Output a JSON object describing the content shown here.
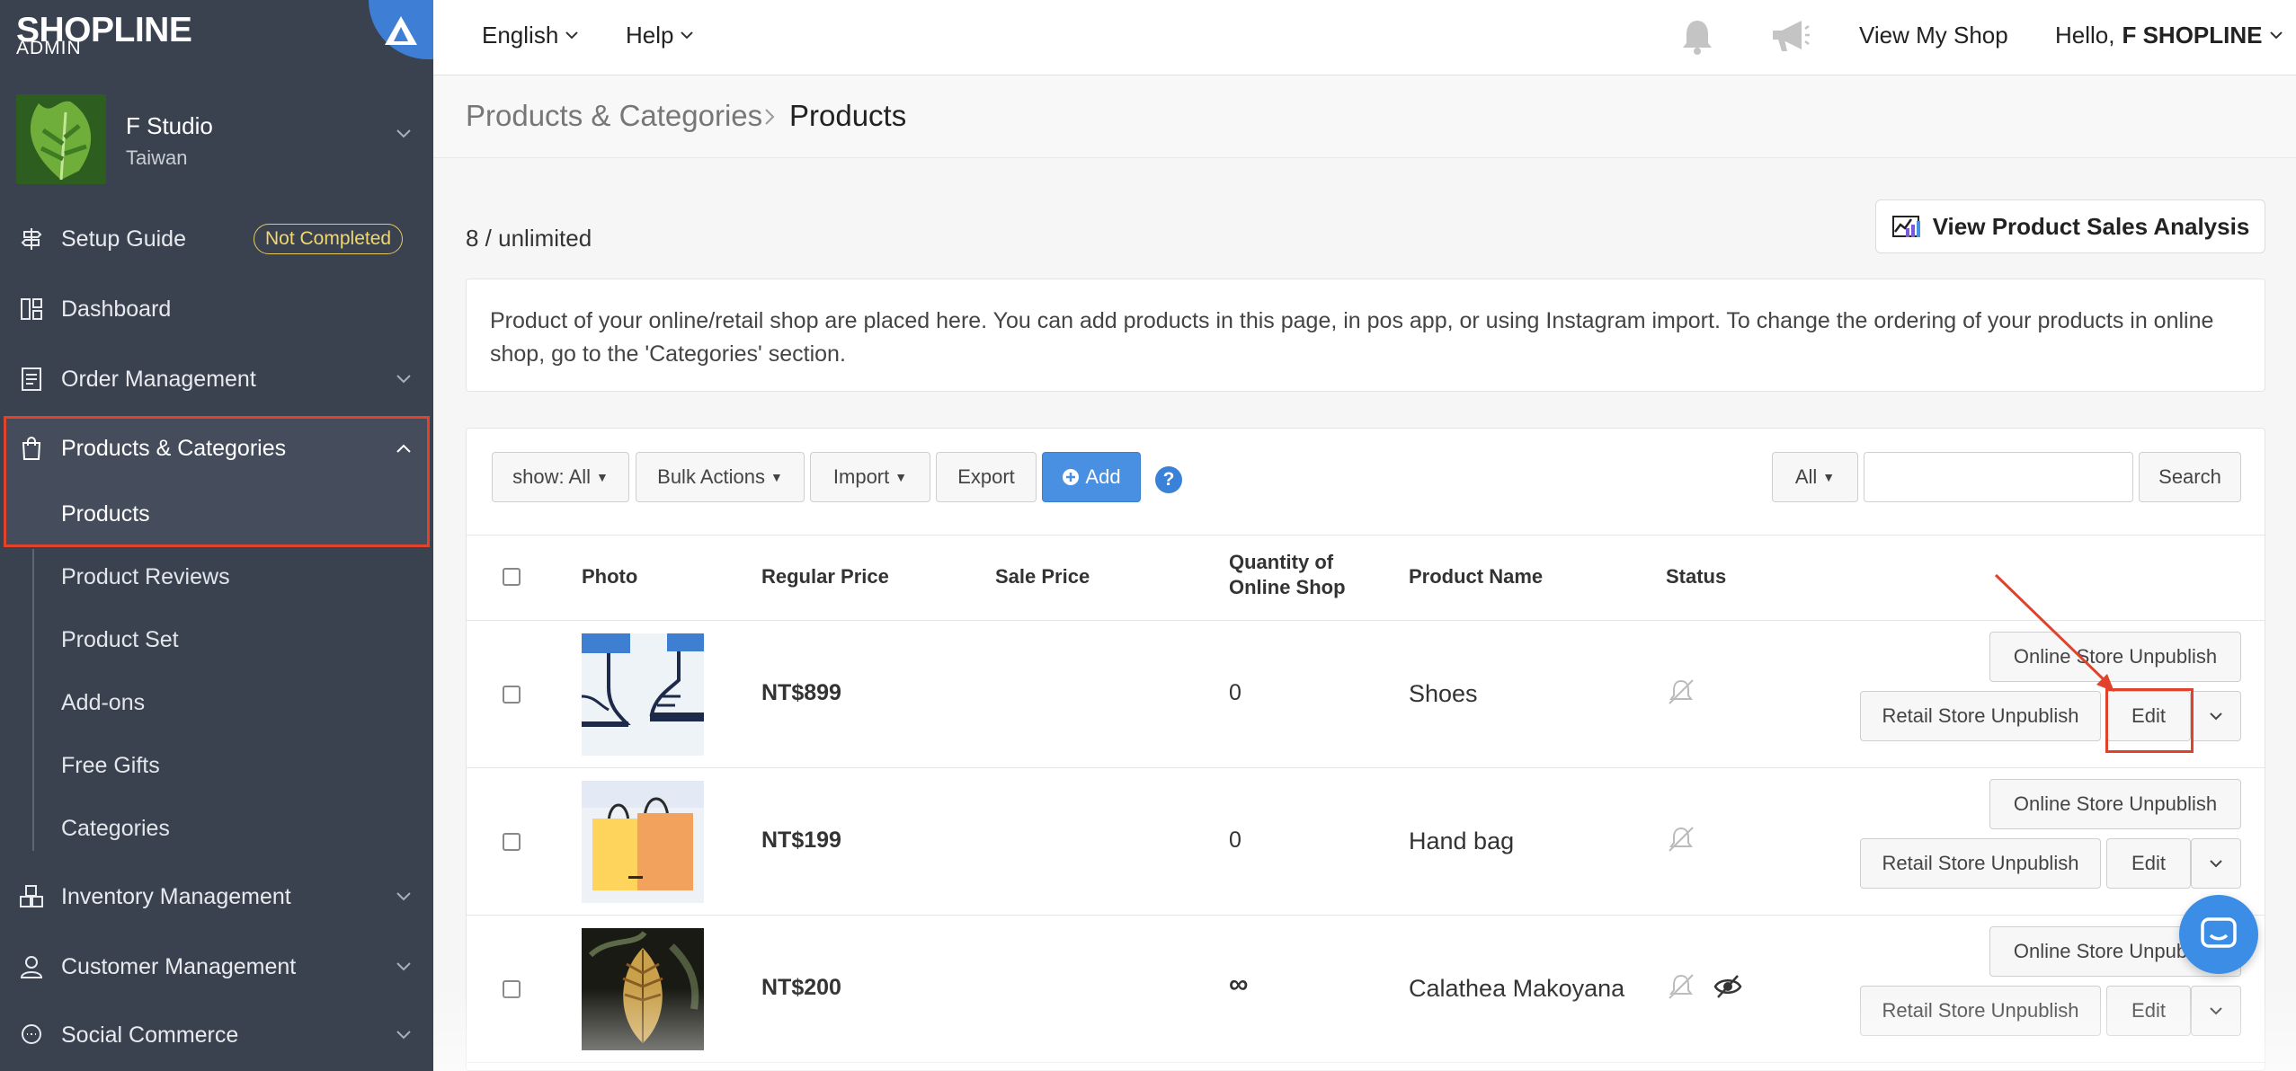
{
  "brand": {
    "name": "SHOPLINE",
    "sub": "ADMIN"
  },
  "store": {
    "name": "F Studio",
    "region": "Taiwan"
  },
  "sidebar": {
    "items": [
      {
        "label": "Setup Guide",
        "badge": "Not Completed"
      },
      {
        "label": "Dashboard"
      },
      {
        "label": "Order Management"
      },
      {
        "label": "Products & Categories"
      },
      {
        "label": "Inventory Management"
      },
      {
        "label": "Customer Management"
      },
      {
        "label": "Social Commerce"
      }
    ],
    "sub_items": [
      "Products",
      "Product Reviews",
      "Product Set",
      "Add-ons",
      "Free Gifts",
      "Categories"
    ]
  },
  "topbar": {
    "language": "English",
    "help": "Help",
    "view_shop": "View My Shop",
    "greeting": "Hello,",
    "user": "F SHOPLINE"
  },
  "breadcrumb": {
    "parent": "Products & Categories",
    "current": "Products"
  },
  "count_text": "8 / unlimited",
  "analysis_button": "View Product Sales Analysis",
  "info_text": "Product of your online/retail shop are placed here. You can add products in this page, in pos app, or using Instagram import. To change the ordering of your products in online shop, go to the 'Categories' section.",
  "toolbar": {
    "show": "show: All",
    "bulk": "Bulk Actions",
    "import": "Import",
    "export": "Export",
    "add": "Add",
    "help": "?",
    "filter": "All",
    "search_placeholder": "",
    "search": "Search"
  },
  "table": {
    "headers": {
      "photo": "Photo",
      "regular_price": "Regular Price",
      "sale_price": "Sale Price",
      "qty_line1": "Quantity of",
      "qty_line2": "Online Shop",
      "name": "Product Name",
      "status": "Status"
    },
    "rows": [
      {
        "price": "NT$899",
        "qty": "0",
        "name": "Shoes"
      },
      {
        "price": "NT$199",
        "qty": "0",
        "name": "Hand bag"
      },
      {
        "price": "NT$200",
        "qty": "∞",
        "name": "Calathea Makoyana"
      }
    ],
    "actions": {
      "online_unpublish": "Online Store Unpublish",
      "retail_unpublish": "Retail Store Unpublish",
      "edit": "Edit"
    }
  },
  "colors": {
    "sidebar": "#3a4250",
    "primary": "#4a90e2",
    "highlight": "#e0432b",
    "badge": "#f1d76e"
  }
}
